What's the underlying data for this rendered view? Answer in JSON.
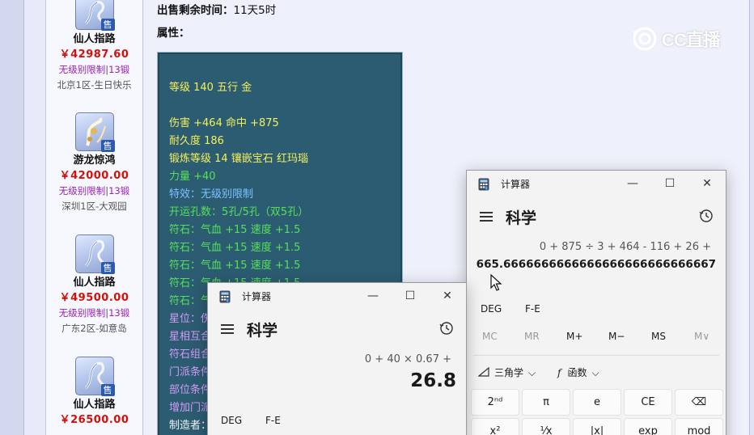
{
  "listing": {
    "items": [
      {
        "name": "仙人指路",
        "price": "￥42987.60",
        "limit": "无级别限制",
        "sep": "|",
        "forge": "13锻",
        "server": "北京1区-生日快乐",
        "sold": "售"
      },
      {
        "name": "游龙惊鸿",
        "price": "￥42000.00",
        "limit": "无级别限制",
        "sep": "|",
        "forge": "13锻",
        "server": "深圳1区-大观园",
        "sold": "售"
      },
      {
        "name": "仙人指路",
        "price": "￥49500.00",
        "limit": "无级别限制",
        "sep": "|",
        "forge": "13锻",
        "server": "广东2区-如意岛",
        "sold": "售"
      },
      {
        "name": "仙人指路",
        "price": "￥26500.00",
        "limit": "",
        "sep": "",
        "forge": "",
        "server": "",
        "sold": "售"
      }
    ]
  },
  "detail": {
    "time_label": "出售剩余时间：",
    "time_value": "11天5时",
    "attr_label": "属性："
  },
  "attributes": [
    {
      "text": "等级 140 五行 金",
      "color": "yellow"
    },
    {
      "text": "伤害 +464 命中 +875",
      "color": "yellow"
    },
    {
      "text": "耐久度 186",
      "color": "yellow"
    },
    {
      "text": "锻炼等级 14 镶嵌宝石 红玛瑙",
      "color": "yellow"
    },
    {
      "text": "力量 +40",
      "color": "green"
    },
    {
      "text": "特效：无级别限制",
      "color": "blue"
    },
    {
      "text": "开运孔数：5孔/5孔（双5孔）",
      "color": "green"
    },
    {
      "text": "符石：气血 +15 速度 +1.5",
      "color": "green"
    },
    {
      "text": "符石：气血 +15 速度 +1.5",
      "color": "green"
    },
    {
      "text": "符石：气血 +15 速度 +1.5",
      "color": "green"
    },
    {
      "text": "符石：气血 +15 速度 +1.5",
      "color": "green"
    },
    {
      "text": "符石：气",
      "color": "green"
    },
    {
      "text": "星位：伤",
      "color": "pink"
    },
    {
      "text": "星相互合",
      "color": "pink"
    },
    {
      "text": "符石组合",
      "color": "pink"
    },
    {
      "text": "门派条件",
      "color": "pink"
    },
    {
      "text": "部位条件",
      "color": "pink"
    },
    {
      "text": "增加门派",
      "color": "pink"
    },
    {
      "text": "制造者：",
      "color": "white"
    }
  ],
  "watermark": {
    "text": "CC直播"
  },
  "calc_back": {
    "title": "计算器",
    "mode": "科学",
    "expression": "0 + 875 ÷ 3 + 464 - 116 + 26 +",
    "result": "665.6666666666666666666666666667",
    "angle_unit": "DEG",
    "notation": "F-E",
    "memory": [
      "MC",
      "MR",
      "M+",
      "M−",
      "MS",
      "M∨"
    ],
    "trig_label": "三角学",
    "func_label": "函数",
    "keys_row1": [
      "2ⁿᵈ",
      "π",
      "e",
      "CE",
      "⌫"
    ],
    "keys_row2": [
      "x²",
      "¹⁄x",
      "|x|",
      "exp",
      "mod"
    ]
  },
  "calc_front": {
    "title": "计算器",
    "mode": "科学",
    "expression": "0 + 40 × 0.67 +",
    "result": "26.8",
    "angle_unit": "DEG",
    "notation": "F-E"
  },
  "window_buttons": {
    "minimize": "—",
    "maximize": "☐",
    "close": "✕"
  }
}
